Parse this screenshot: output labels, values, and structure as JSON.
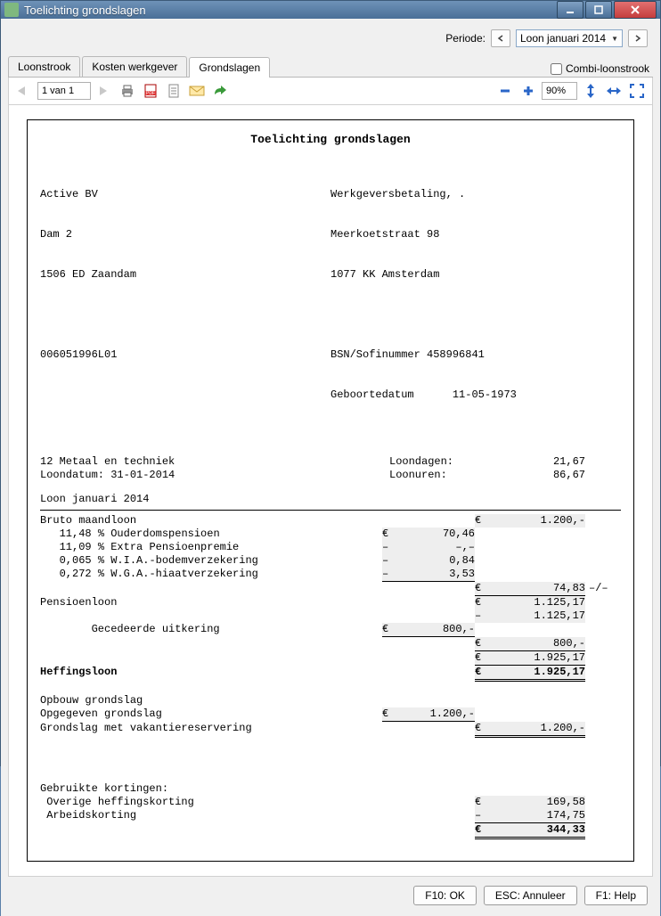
{
  "window": {
    "title": "Toelichting grondslagen"
  },
  "period": {
    "label": "Periode:",
    "value": "Loon januari 2014"
  },
  "tabs": {
    "items": [
      "Loonstrook",
      "Kosten werkgever",
      "Grondslagen"
    ],
    "active": 2,
    "combi_label": "Combi-loonstrook"
  },
  "toolbar": {
    "page": "1 van 1",
    "zoom": "90%"
  },
  "report": {
    "title": "Toelichting grondslagen",
    "company": {
      "name": "Active BV",
      "street": "Dam 2",
      "city": "1506 ED Zaandam",
      "id": "006051996L01"
    },
    "employee": {
      "payment": "Werkgeversbetaling, .",
      "street": "Meerkoetstraat 98",
      "city": "1077 KK Amsterdam",
      "bsn_label": "BSN/Sofinummer",
      "bsn": "458996841",
      "dob_label": "Geboortedatum",
      "dob": "11-05-1973"
    },
    "meta": {
      "sector": "12 Metaal en techniek",
      "loondatum_label": "Loondatum:",
      "loondatum": "31-01-2014",
      "loondagen_label": "Loondagen:",
      "loondagen": "21,67",
      "loonuren_label": "Loonuren:",
      "loonuren": "86,67",
      "period": "Loon januari 2014"
    },
    "lines": {
      "bruto_label": "Bruto maandloon",
      "bruto_cur": "€",
      "bruto_val": "1.200,-",
      "d1": {
        "pct": "11,48 %",
        "name": "Ouderdomspensioen",
        "cur": "€",
        "val": "70,46"
      },
      "d2": {
        "pct": "11,09 %",
        "name": "Extra Pensioenpremie",
        "cur": "–",
        "val": "–,–"
      },
      "d3": {
        "pct": "0,065 %",
        "name": "W.I.A.-bodemverzekering",
        "cur": "–",
        "val": "0,84"
      },
      "d4": {
        "pct": "0,272 %",
        "name": "W.G.A.-hiaatverzekering",
        "cur": "–",
        "val": "3,53"
      },
      "sub1_cur": "€",
      "sub1_val": "74,83",
      "sub1_tail": "–/–",
      "pensioen_label": "Pensioenloon",
      "pensioen_cur": "€",
      "pensioen_val": "1.125,17",
      "pensioen2_cur": "–",
      "pensioen2_val": "1.125,17",
      "geced_label": "Gecedeerde uitkering",
      "geced_cur": "€",
      "geced_val": "800,-",
      "sub2_cur": "€",
      "sub2_val": "800,-",
      "sub3_cur": "€",
      "sub3_val": "1.925,17",
      "heff_label": "Heffingsloon",
      "heff_cur": "€",
      "heff_val": "1.925,17",
      "opbouw": "Opbouw grondslag",
      "opgegeven_label": "Opgegeven grondslag",
      "opgegeven_cur": "€",
      "opgegeven_val": "1.200,-",
      "grondslag_label": "Grondslag met vakantiereservering",
      "grondslag_cur": "€",
      "grondslag_val": "1.200,-",
      "kortingen_header": "Gebruikte kortingen:",
      "k1_label": "Overige heffingskorting",
      "k1_cur": "€",
      "k1_val": "169,58",
      "k2_label": "Arbeidskorting",
      "k2_cur": "–",
      "k2_val": "174,75",
      "ktot_cur": "€",
      "ktot_val": "344,33"
    }
  },
  "buttons": {
    "ok": "F10: OK",
    "cancel": "ESC: Annuleer",
    "help": "F1: Help"
  }
}
